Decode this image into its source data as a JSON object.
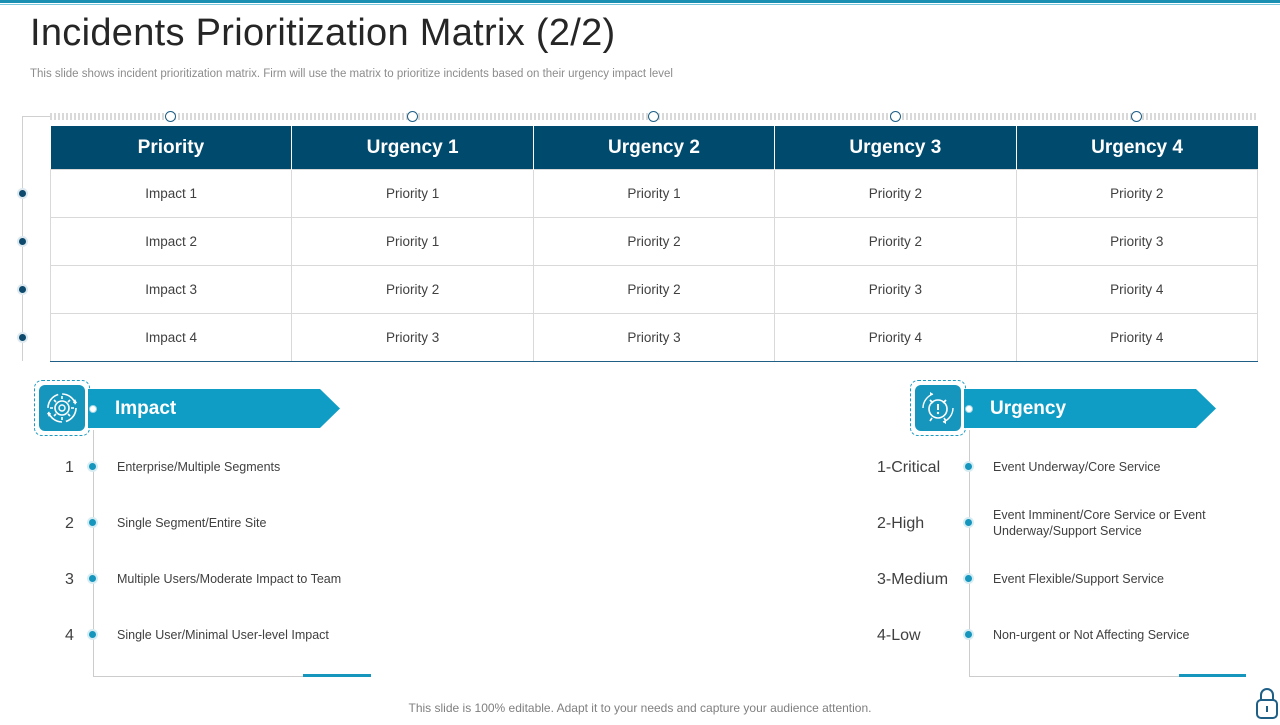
{
  "title": "Incidents Prioritization Matrix (2/2)",
  "subtitle": "This slide shows incident prioritization matrix. Firm will use the matrix to  prioritize incidents based on their urgency impact level",
  "matrix": {
    "headers": [
      "Priority",
      "Urgency 1",
      "Urgency 2",
      "Urgency 3",
      "Urgency 4"
    ],
    "rows": [
      [
        "Impact 1",
        "Priority 1",
        "Priority 1",
        "Priority 2",
        "Priority 2"
      ],
      [
        "Impact 2",
        "Priority 1",
        "Priority 2",
        "Priority 2",
        "Priority 3"
      ],
      [
        "Impact 3",
        "Priority 2",
        "Priority 2",
        "Priority 3",
        "Priority 4"
      ],
      [
        "Impact 4",
        "Priority 3",
        "Priority 3",
        "Priority 4",
        "Priority 4"
      ]
    ]
  },
  "impact": {
    "heading": "Impact",
    "icon": "gear-cycle-icon",
    "items": [
      {
        "num": "1",
        "text": "Enterprise/Multiple  Segments"
      },
      {
        "num": "2",
        "text": "Single Segment/Entire Site"
      },
      {
        "num": "3",
        "text": "Multiple Users/Moderate  Impact to Team"
      },
      {
        "num": "4",
        "text": "Single User/Minimal  User-level  Impact"
      }
    ]
  },
  "urgency": {
    "heading": "Urgency",
    "icon": "alarm-clock-alert-icon",
    "items": [
      {
        "num": "1-Critical",
        "text": "Event Underway/Core  Service"
      },
      {
        "num": "2-High",
        "text": "Event Imminent/Core  Service  or Event Underway/Support  Service"
      },
      {
        "num": "3-Medium",
        "text": "Event Flexible/Support  Service"
      },
      {
        "num": "4-Low",
        "text": "Non-urgent  or Not Affecting Service"
      }
    ]
  },
  "footer": "This slide is 100% editable. Adapt it to your  needs and capture your audience attention.",
  "colors": {
    "header": "#004a6e",
    "accent": "#0f9dc5",
    "topbar": "#1b8fb1"
  }
}
